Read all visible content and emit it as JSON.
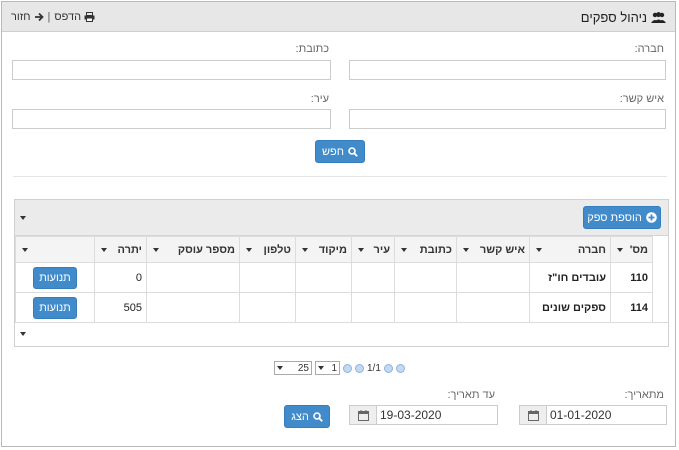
{
  "header": {
    "title": "ניהול ספקים",
    "print_label": "הדפס",
    "separator": "|",
    "back_label": "חזור"
  },
  "search": {
    "company_label": "חברה:",
    "address_label": "כתובת:",
    "contact_label": "איש קשר:",
    "city_label": "עיר:",
    "company_value": "",
    "address_value": "",
    "contact_value": "",
    "city_value": "",
    "search_button": "חפש"
  },
  "grid": {
    "add_button": "הוספת ספק",
    "columns": [
      "מס'",
      "חברה",
      "איש קשר",
      "כתובת",
      "עיר",
      "מיקוד",
      "טלפון",
      "מספר עוסק",
      "יתרה",
      ""
    ],
    "rows": [
      {
        "num": "110",
        "company": "עובדים חו\"ז",
        "contact": "",
        "address": "",
        "city": "",
        "zip": "",
        "phone": "",
        "dealer": "",
        "balance": "0",
        "action": "תנועות"
      },
      {
        "num": "114",
        "company": "ספקים שונים",
        "contact": "",
        "address": "",
        "city": "",
        "zip": "",
        "phone": "",
        "dealer": "",
        "balance": "505",
        "action": "תנועות"
      }
    ]
  },
  "pager": {
    "page_size": "25",
    "page": "1",
    "pages": "1/1"
  },
  "dates": {
    "from_label": "מתאריך:",
    "to_label": "עד תאריך:",
    "from_value": "01-01-2020",
    "to_value": "19-03-2020",
    "show_button": "הצג"
  },
  "colors": {
    "primary": "#428bca",
    "topbar": "#e7e7e7"
  }
}
